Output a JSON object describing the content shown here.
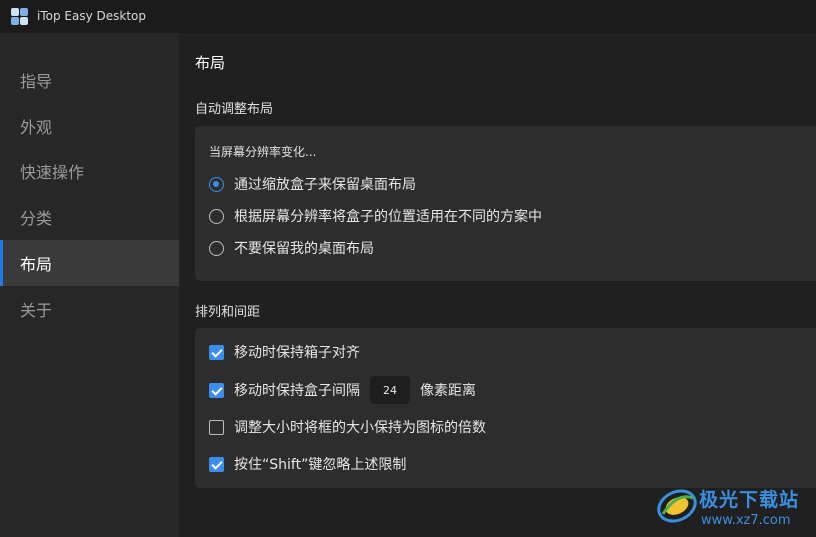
{
  "window": {
    "title": "iTop Easy Desktop"
  },
  "sidebar": {
    "items": [
      {
        "label": "指导",
        "active": false
      },
      {
        "label": "外观",
        "active": false
      },
      {
        "label": "快速操作",
        "active": false
      },
      {
        "label": "分类",
        "active": false
      },
      {
        "label": "布局",
        "active": true
      },
      {
        "label": "关于",
        "active": false
      }
    ]
  },
  "main": {
    "page_title": "布局",
    "auto_layout": {
      "section_title": "自动调整布局",
      "sub_label": "当屏幕分辨率变化...",
      "options": [
        {
          "label": "通过缩放盒子来保留桌面布局",
          "selected": true
        },
        {
          "label": "根据屏幕分辨率将盒子的位置适用在不同的方案中",
          "selected": false
        },
        {
          "label": "不要保留我的桌面布局",
          "selected": false
        }
      ]
    },
    "arrangement": {
      "section_title": "排列和间距",
      "keep_aligned": {
        "label": "移动时保持箱子对齐",
        "checked": true
      },
      "keep_spacing": {
        "label": "移动时保持盒子间隔",
        "value": "24",
        "unit": "像素距离",
        "checked": true
      },
      "icon_multiple": {
        "label": "调整大小时将框的大小保持为图标的倍数",
        "checked": false
      },
      "shift_ignore": {
        "label": "按住“Shift”键忽略上述限制",
        "checked": true
      }
    }
  },
  "watermark": {
    "name": "极光下载站",
    "url": "www.xz7.com"
  },
  "colors": {
    "accent": "#3b8ef0",
    "sidebar_bg": "#272727",
    "card_bg": "#2d2d2d",
    "window_bg": "#202020"
  }
}
